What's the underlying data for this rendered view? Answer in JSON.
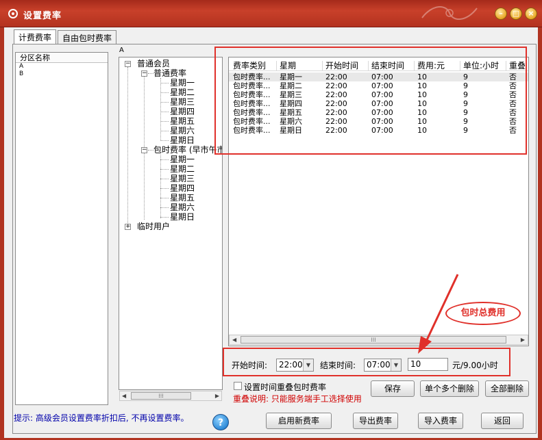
{
  "window": {
    "title": "设置费率"
  },
  "tabs": [
    {
      "label": "计费费率",
      "active": true
    },
    {
      "label": "自由包时费率",
      "active": false
    }
  ],
  "zone_list": {
    "header": "分区名称",
    "items": [
      "A",
      "B"
    ]
  },
  "group_label": "A",
  "tree": {
    "root": "普通会员",
    "normal_rate": "普通费率",
    "package_rate": "包时费率 (早市午市",
    "days": [
      "星期一",
      "星期二",
      "星期三",
      "星期四",
      "星期五",
      "星期六",
      "星期日"
    ],
    "temp_user": "临时用户"
  },
  "rate_table": {
    "columns": [
      "费率类别",
      "星期",
      "开始时间",
      "结束时间",
      "费用:元",
      "单位:小时",
      "重叠"
    ],
    "rows": [
      [
        "包时费率...",
        "星期一",
        "22:00",
        "07:00",
        "10",
        "9",
        "否"
      ],
      [
        "包时费率...",
        "星期二",
        "22:00",
        "07:00",
        "10",
        "9",
        "否"
      ],
      [
        "包时费率...",
        "星期三",
        "22:00",
        "07:00",
        "10",
        "9",
        "否"
      ],
      [
        "包时费率...",
        "星期四",
        "22:00",
        "07:00",
        "10",
        "9",
        "否"
      ],
      [
        "包时费率...",
        "星期五",
        "22:00",
        "07:00",
        "10",
        "9",
        "否"
      ],
      [
        "包时费率...",
        "星期六",
        "22:00",
        "07:00",
        "10",
        "9",
        "否"
      ],
      [
        "包时费率...",
        "星期日",
        "22:00",
        "07:00",
        "10",
        "9",
        "否"
      ]
    ]
  },
  "time_settings": {
    "start_label": "开始时间:",
    "start_value": "22:00",
    "end_label": "结束时间:",
    "end_value": "07:00",
    "fee_value": "10",
    "fee_unit": "元/9.00小时"
  },
  "overlap": {
    "checkbox_label": "设置时间重叠包时费率",
    "checked": false,
    "note": "重叠说明: 只能服务端手工选择使用"
  },
  "tip": "提示: 高级会员设置费率折扣后, 不再设置费率。",
  "callout": "包时总费用",
  "buttons": {
    "save": "保存",
    "delete_multi": "单个多个删除",
    "delete_all": "全部删除",
    "enable_new": "启用新费率",
    "export": "导出费率",
    "import": "导入费率",
    "back": "返回"
  },
  "colors": {
    "titlebar": "#b3321f",
    "annotation": "#e0302a",
    "note": "#d00000",
    "tip": "#0000aa"
  }
}
